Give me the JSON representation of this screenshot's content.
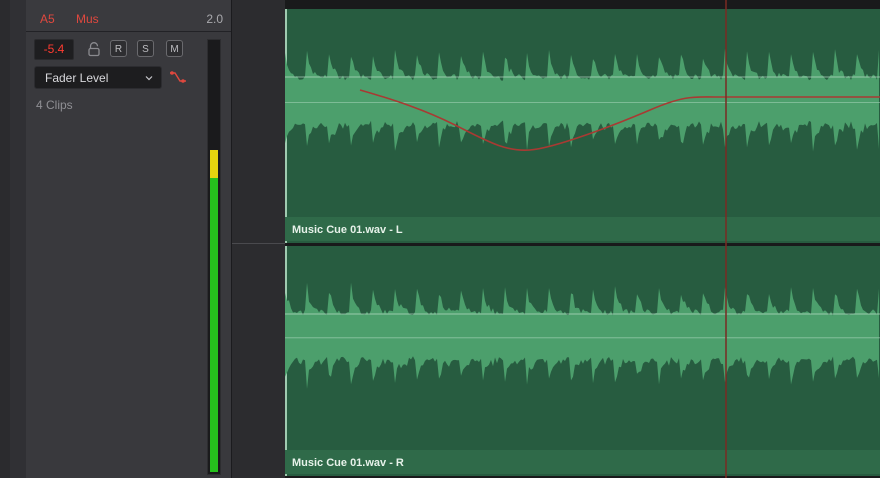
{
  "track": {
    "id": "A5",
    "name": "Mus",
    "level": "2.0",
    "volume": "-5.4",
    "buttons": {
      "record": "R",
      "solo": "S",
      "mute": "M"
    },
    "automation_mode": "Fader Level",
    "clips_count": "4 Clips",
    "meter_level": 0.68,
    "meter_yellow_fraction": 0.065
  },
  "clips": [
    {
      "label": "Music Cue 01.wav - L",
      "channel": "L",
      "has_volume_curve": true
    },
    {
      "label": "Music Cue 01.wav - R",
      "channel": "R",
      "has_volume_curve": false
    }
  ],
  "colors": {
    "clip_bg": "#275c40",
    "waveform": "#4c9f6c",
    "clip_label_bar": "#2f6a49",
    "volume_curve": "#a83a33",
    "playhead": "#7a2a23",
    "accent_red": "#e0483e"
  },
  "icons": [
    "lock-icon",
    "chevron-down-icon",
    "keyframe-icon"
  ]
}
